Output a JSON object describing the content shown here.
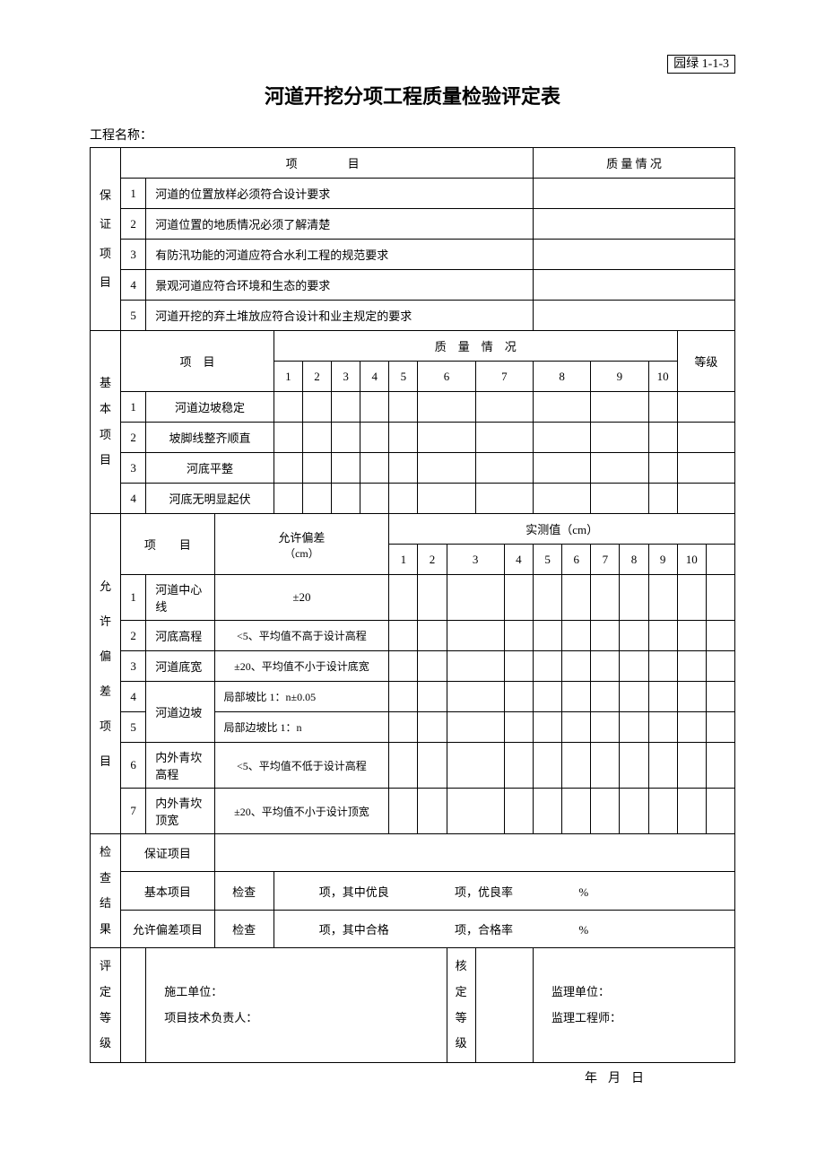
{
  "doc_code": "园绿 1-1-3",
  "title": "河道开挖分项工程质量检验评定表",
  "project_label": "工程名称：",
  "section1": {
    "header": "保证项目",
    "col_item": "项　　目",
    "col_quality": "质 量 情 况",
    "rows": [
      {
        "num": "1",
        "text": "河道的位置放样必须符合设计要求"
      },
      {
        "num": "2",
        "text": "河道位置的地质情况必须了解清楚"
      },
      {
        "num": "3",
        "text": "有防汛功能的河道应符合水利工程的规范要求"
      },
      {
        "num": "4",
        "text": "景观河道应符合环境和生态的要求"
      },
      {
        "num": "5",
        "text": "河道开挖的弃土堆放应符合设计和业主规定的要求"
      }
    ]
  },
  "section2": {
    "header": "基本项目",
    "col_item": "项　目",
    "col_quality": "质　量　情　况",
    "col_grade": "等级",
    "numbers": [
      "1",
      "2",
      "3",
      "4",
      "5",
      "6",
      "7",
      "8",
      "9",
      "10"
    ],
    "rows": [
      {
        "num": "1",
        "text": "河道边坡稳定"
      },
      {
        "num": "2",
        "text": "坡脚线整齐顺直"
      },
      {
        "num": "3",
        "text": "河底平整"
      },
      {
        "num": "4",
        "text": "河底无明显起伏"
      }
    ]
  },
  "section3": {
    "header": "允许偏差项目",
    "col_item": "项　　目",
    "col_tol": "允许偏差",
    "col_tol_unit": "（cm）",
    "col_meas": "实测值（cm）",
    "numbers": [
      "1",
      "2",
      "3",
      "4",
      "5",
      "6",
      "7",
      "8",
      "9",
      "10"
    ],
    "rows": [
      {
        "num": "1",
        "name": "河道中心线",
        "tol": "±20"
      },
      {
        "num": "2",
        "name": "河底高程",
        "tol": "<5、平均值不高于设计高程"
      },
      {
        "num": "3",
        "name": "河道底宽",
        "tol": "±20、平均值不小于设计底宽"
      },
      {
        "num": "4",
        "name": "河道边坡",
        "tol": "局部坡比 1：n±0.05"
      },
      {
        "num": "5",
        "name": "",
        "tol": "局部边坡比 1：n"
      },
      {
        "num": "6",
        "name": "内外青坎高程",
        "tol": "<5、平均值不低于设计高程"
      },
      {
        "num": "7",
        "name": "内外青坎顶宽",
        "tol": "±20、平均值不小于设计顶宽"
      }
    ]
  },
  "results": {
    "header": "检查结果",
    "row_guarantee": "保证项目",
    "row_basic_label": "基本项目",
    "row_dev_label": "允许偏差项目",
    "check_word": "检查",
    "basic_text1": "项，其中优良",
    "basic_text2": "项，优良率",
    "dev_text1": "项，其中合格",
    "dev_text2": "项，合格率",
    "percent": "%"
  },
  "eval": {
    "header": "评定等级",
    "left_org": "施工单位：",
    "left_person": "项目技术负责人：",
    "mid": "核定等级",
    "right_org": "监理单位：",
    "right_person": "监理工程师："
  },
  "date": {
    "year": "年",
    "month": "月",
    "day": "日"
  }
}
